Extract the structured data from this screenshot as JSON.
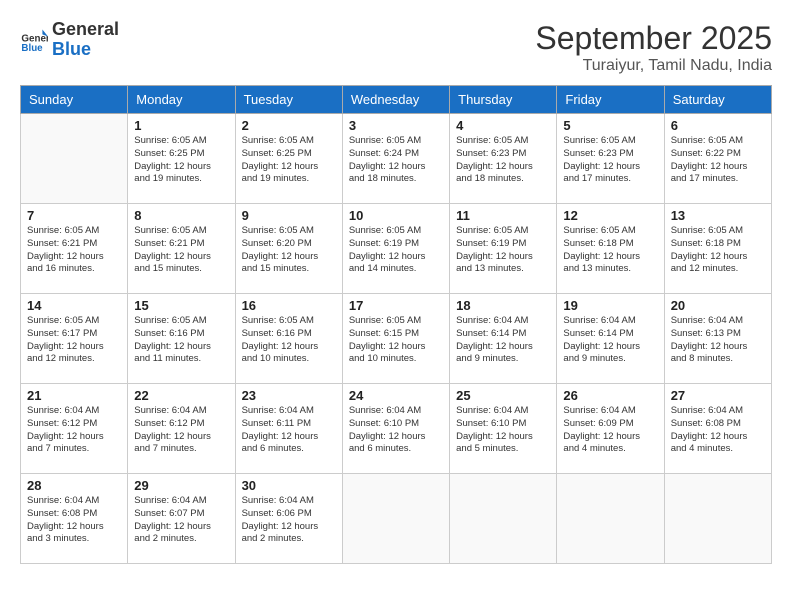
{
  "header": {
    "logo_line1": "General",
    "logo_line2": "Blue",
    "month": "September 2025",
    "location": "Turaiyur, Tamil Nadu, India"
  },
  "days_of_week": [
    "Sunday",
    "Monday",
    "Tuesday",
    "Wednesday",
    "Thursday",
    "Friday",
    "Saturday"
  ],
  "weeks": [
    [
      {
        "day": "",
        "info": ""
      },
      {
        "day": "1",
        "info": "Sunrise: 6:05 AM\nSunset: 6:25 PM\nDaylight: 12 hours\nand 19 minutes."
      },
      {
        "day": "2",
        "info": "Sunrise: 6:05 AM\nSunset: 6:25 PM\nDaylight: 12 hours\nand 19 minutes."
      },
      {
        "day": "3",
        "info": "Sunrise: 6:05 AM\nSunset: 6:24 PM\nDaylight: 12 hours\nand 18 minutes."
      },
      {
        "day": "4",
        "info": "Sunrise: 6:05 AM\nSunset: 6:23 PM\nDaylight: 12 hours\nand 18 minutes."
      },
      {
        "day": "5",
        "info": "Sunrise: 6:05 AM\nSunset: 6:23 PM\nDaylight: 12 hours\nand 17 minutes."
      },
      {
        "day": "6",
        "info": "Sunrise: 6:05 AM\nSunset: 6:22 PM\nDaylight: 12 hours\nand 17 minutes."
      }
    ],
    [
      {
        "day": "7",
        "info": "Sunrise: 6:05 AM\nSunset: 6:21 PM\nDaylight: 12 hours\nand 16 minutes."
      },
      {
        "day": "8",
        "info": "Sunrise: 6:05 AM\nSunset: 6:21 PM\nDaylight: 12 hours\nand 15 minutes."
      },
      {
        "day": "9",
        "info": "Sunrise: 6:05 AM\nSunset: 6:20 PM\nDaylight: 12 hours\nand 15 minutes."
      },
      {
        "day": "10",
        "info": "Sunrise: 6:05 AM\nSunset: 6:19 PM\nDaylight: 12 hours\nand 14 minutes."
      },
      {
        "day": "11",
        "info": "Sunrise: 6:05 AM\nSunset: 6:19 PM\nDaylight: 12 hours\nand 13 minutes."
      },
      {
        "day": "12",
        "info": "Sunrise: 6:05 AM\nSunset: 6:18 PM\nDaylight: 12 hours\nand 13 minutes."
      },
      {
        "day": "13",
        "info": "Sunrise: 6:05 AM\nSunset: 6:18 PM\nDaylight: 12 hours\nand 12 minutes."
      }
    ],
    [
      {
        "day": "14",
        "info": "Sunrise: 6:05 AM\nSunset: 6:17 PM\nDaylight: 12 hours\nand 12 minutes."
      },
      {
        "day": "15",
        "info": "Sunrise: 6:05 AM\nSunset: 6:16 PM\nDaylight: 12 hours\nand 11 minutes."
      },
      {
        "day": "16",
        "info": "Sunrise: 6:05 AM\nSunset: 6:16 PM\nDaylight: 12 hours\nand 10 minutes."
      },
      {
        "day": "17",
        "info": "Sunrise: 6:05 AM\nSunset: 6:15 PM\nDaylight: 12 hours\nand 10 minutes."
      },
      {
        "day": "18",
        "info": "Sunrise: 6:04 AM\nSunset: 6:14 PM\nDaylight: 12 hours\nand 9 minutes."
      },
      {
        "day": "19",
        "info": "Sunrise: 6:04 AM\nSunset: 6:14 PM\nDaylight: 12 hours\nand 9 minutes."
      },
      {
        "day": "20",
        "info": "Sunrise: 6:04 AM\nSunset: 6:13 PM\nDaylight: 12 hours\nand 8 minutes."
      }
    ],
    [
      {
        "day": "21",
        "info": "Sunrise: 6:04 AM\nSunset: 6:12 PM\nDaylight: 12 hours\nand 7 minutes."
      },
      {
        "day": "22",
        "info": "Sunrise: 6:04 AM\nSunset: 6:12 PM\nDaylight: 12 hours\nand 7 minutes."
      },
      {
        "day": "23",
        "info": "Sunrise: 6:04 AM\nSunset: 6:11 PM\nDaylight: 12 hours\nand 6 minutes."
      },
      {
        "day": "24",
        "info": "Sunrise: 6:04 AM\nSunset: 6:10 PM\nDaylight: 12 hours\nand 6 minutes."
      },
      {
        "day": "25",
        "info": "Sunrise: 6:04 AM\nSunset: 6:10 PM\nDaylight: 12 hours\nand 5 minutes."
      },
      {
        "day": "26",
        "info": "Sunrise: 6:04 AM\nSunset: 6:09 PM\nDaylight: 12 hours\nand 4 minutes."
      },
      {
        "day": "27",
        "info": "Sunrise: 6:04 AM\nSunset: 6:08 PM\nDaylight: 12 hours\nand 4 minutes."
      }
    ],
    [
      {
        "day": "28",
        "info": "Sunrise: 6:04 AM\nSunset: 6:08 PM\nDaylight: 12 hours\nand 3 minutes."
      },
      {
        "day": "29",
        "info": "Sunrise: 6:04 AM\nSunset: 6:07 PM\nDaylight: 12 hours\nand 2 minutes."
      },
      {
        "day": "30",
        "info": "Sunrise: 6:04 AM\nSunset: 6:06 PM\nDaylight: 12 hours\nand 2 minutes."
      },
      {
        "day": "",
        "info": ""
      },
      {
        "day": "",
        "info": ""
      },
      {
        "day": "",
        "info": ""
      },
      {
        "day": "",
        "info": ""
      }
    ]
  ]
}
